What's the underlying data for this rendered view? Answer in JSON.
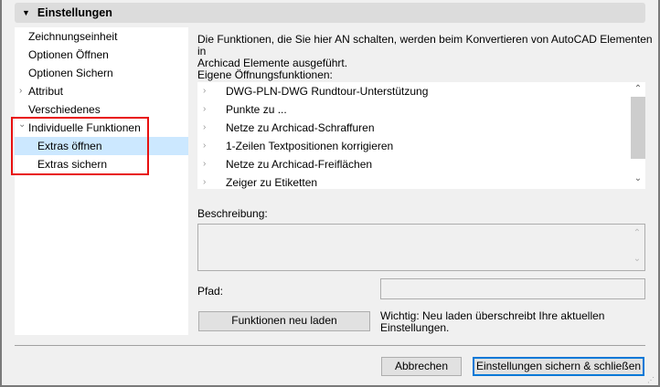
{
  "header": {
    "title": "Einstellungen"
  },
  "tree": [
    {
      "label": "Zeichnungseinheit",
      "expander": ""
    },
    {
      "label": "Optionen Öffnen",
      "expander": ""
    },
    {
      "label": "Optionen Sichern",
      "expander": ""
    },
    {
      "label": "Attribut",
      "expander": "›"
    },
    {
      "label": "Verschiedenes",
      "expander": ""
    },
    {
      "label": "Individuelle Funktionen",
      "expander": "⌄"
    },
    {
      "label": "Extras öffnen",
      "expander": "",
      "selected": true
    },
    {
      "label": "Extras sichern",
      "expander": ""
    }
  ],
  "intro": {
    "line1": "Die Funktionen, die Sie hier AN schalten, werden beim Konvertieren von AutoCAD Elementen in",
    "line2": "Archicad Elemente ausgeführt.",
    "line3": "Eigene Öffnungsfunktionen:"
  },
  "functions": [
    "DWG-PLN-DWG Rundtour-Unterstützung",
    "Punkte zu ...",
    "Netze zu Archicad-Schraffuren",
    "1-Zeilen Textpositionen korrigieren",
    "Netze zu Archicad-Freiflächen",
    "Zeiger zu Etiketten"
  ],
  "description": {
    "label": "Beschreibung:",
    "value": ""
  },
  "path": {
    "label": "Pfad:",
    "value": ""
  },
  "reload_button": "Funktionen neu laden",
  "reload_note": {
    "line1": "Wichtig: Neu laden überschreibt Ihre aktuellen",
    "line2": "Einstellungen."
  },
  "footer": {
    "cancel": "Abbrechen",
    "save": "Einstellungen sichern & schließen"
  },
  "colors": {
    "selection": "#cce8ff",
    "highlight": "#e81010",
    "default_button": "#0078d7"
  }
}
